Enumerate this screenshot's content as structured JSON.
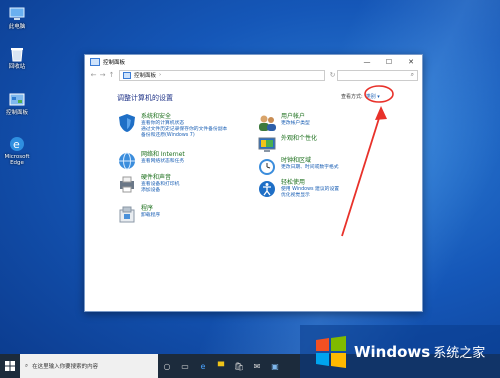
{
  "desktop": {
    "icons": [
      {
        "label": "此电脑"
      },
      {
        "label": "回收站"
      },
      {
        "label": "控制面板"
      },
      {
        "label": "Microsoft Edge"
      }
    ]
  },
  "window": {
    "title": "控制面板",
    "breadcrumb": "控制面板",
    "controls": {
      "minimize": "—",
      "maximize": "☐",
      "close": "✕"
    }
  },
  "content": {
    "heading": "调整计算机的设置",
    "view_by_label": "查看方式:",
    "view_by_value": "类别 ▾",
    "categories_left": [
      {
        "title": "系统和安全",
        "links": [
          "查看你的计算机状态",
          "通过文件历史记录保存你的文件备份副本",
          "备份和还原(Windows 7)"
        ]
      },
      {
        "title": "网络和 Internet",
        "links": [
          "查看网络状态和任务"
        ]
      },
      {
        "title": "硬件和声音",
        "links": [
          "查看设备和打印机",
          "添加设备"
        ]
      },
      {
        "title": "程序",
        "links": [
          "卸载程序"
        ]
      }
    ],
    "categories_right": [
      {
        "title": "用户帐户",
        "links": [
          "更改帐户类型"
        ]
      },
      {
        "title": "外观和个性化",
        "links": []
      },
      {
        "title": "时钟和区域",
        "links": [
          "更改日期、时间或数字格式"
        ]
      },
      {
        "title": "轻松使用",
        "links": [
          "使用 Windows 建议的设置",
          "优化视觉显示"
        ]
      }
    ]
  },
  "taskbar": {
    "search_placeholder": "在这里输入你要搜索的内容"
  },
  "watermark": {
    "brand": "Windows",
    "suffix": "系统之家"
  },
  "colors": {
    "category_title": "#1a6e1a",
    "link": "#1a5fb4",
    "annotation": "#e8312a"
  }
}
